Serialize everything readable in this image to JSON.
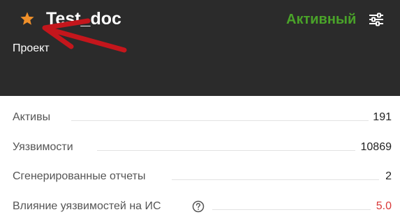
{
  "header": {
    "title": "Test_doc",
    "subtitle": "Проект",
    "status": "Активный",
    "status_color": "#4aa329",
    "star_icon": "star-icon",
    "star_color": "#f0902a",
    "settings_icon": "settings-sliders-icon",
    "annotation_icon": "red-arrow-annotation",
    "annotation_color": "#c4161c"
  },
  "stats": [
    {
      "label": "Активы",
      "value": "191"
    },
    {
      "label": "Уязвимости",
      "value": "10869"
    },
    {
      "label": "Сгенерированные отчеты",
      "value": "2"
    },
    {
      "label": "Влияние уязвимостей на ИС",
      "value": "5.0",
      "value_color": "#d93838",
      "help_icon": "question-circle-icon"
    }
  ]
}
